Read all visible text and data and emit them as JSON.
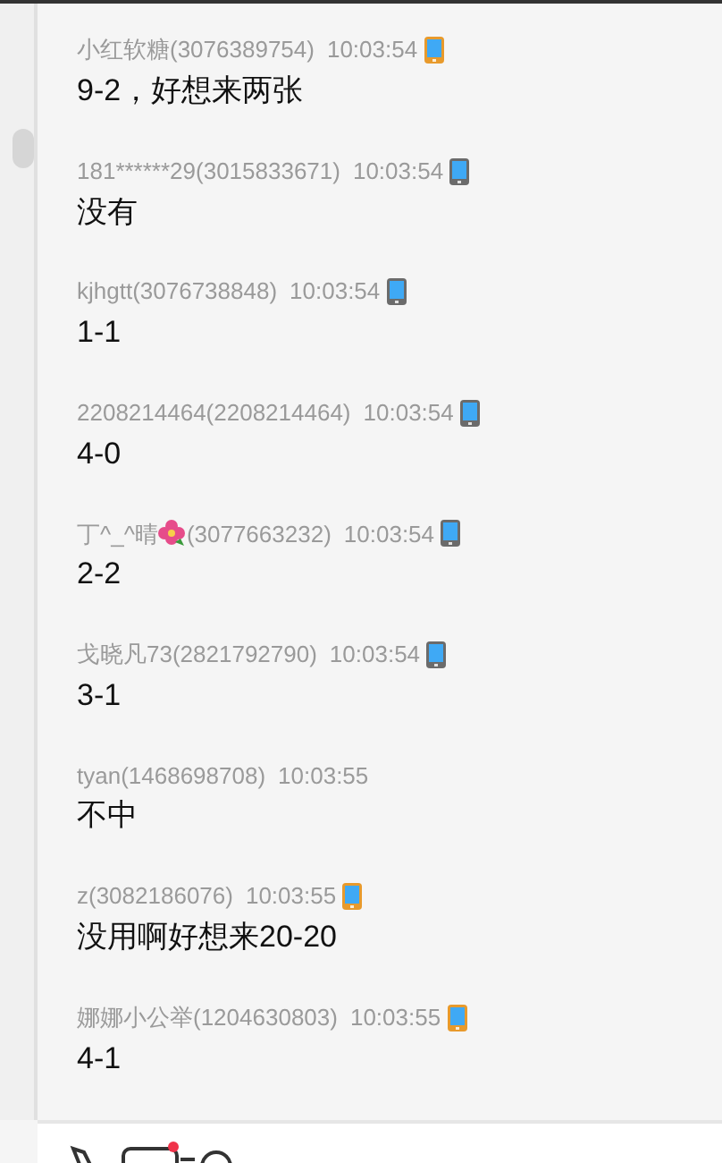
{
  "messages": [
    {
      "sender": "小红软糖(3076389754)",
      "time": "10:03:54",
      "kind": "tablet",
      "text": "9-2，好想来两张"
    },
    {
      "sender": "181******29(3015833671)",
      "time": "10:03:54",
      "kind": "phone",
      "text": "没有"
    },
    {
      "sender": "kjhgtt(3076738848)",
      "time": "10:03:54",
      "kind": "phone",
      "text": "1-1"
    },
    {
      "sender": "2208214464(2208214464)",
      "time": "10:03:54",
      "kind": "phone",
      "text": "4-0"
    },
    {
      "sender": "丁^_^晴",
      "sender_flower": true,
      "sender_id": "(3077663232)",
      "time": "10:03:54",
      "kind": "phone",
      "text": "2-2"
    },
    {
      "sender": "戈晓凡73(2821792790)",
      "time": "10:03:54",
      "kind": "phone",
      "text": "3-1"
    },
    {
      "sender": "tyan(1468698708)",
      "time": "10:03:55",
      "kind": "plain",
      "text": "不中"
    },
    {
      "sender": "z(3082186076)",
      "time": "10:03:55",
      "kind": "tablet",
      "text": "没用啊好想来20-20"
    },
    {
      "sender": "娜娜小公举(1204630803)",
      "time": "10:03:55",
      "kind": "tablet",
      "text": "4-1"
    }
  ]
}
